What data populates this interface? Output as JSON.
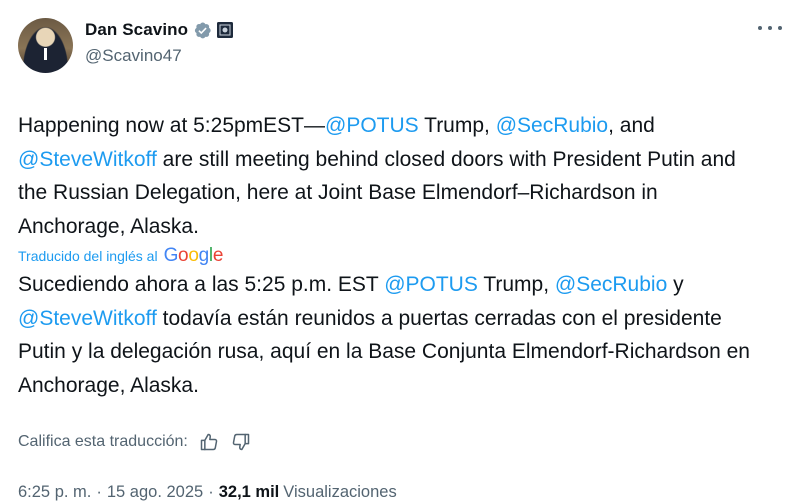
{
  "author": {
    "display_name": "Dan Scavino",
    "handle": "@Scavino47",
    "verified_icon": "verified-badge-icon",
    "affiliation_icon": "government-affiliation-icon"
  },
  "menu_icon": "more-options-icon",
  "tweet": {
    "original": {
      "p1": "Happening now at 5:25pmEST—",
      "m1": "@POTUS",
      "p2": " Trump, ",
      "m2": "@SecRubio",
      "p3": ", and ",
      "m3": "@SteveWitkoff",
      "p4": " are still meeting behind closed doors with President Putin and the Russian Delegation, here at Joint Base Elmendorf–Richardson in Anchorage, Alaska."
    },
    "translated_by_label": "Traducido del inglés al",
    "google_logo": [
      "G",
      "o",
      "o",
      "g",
      "l",
      "e"
    ],
    "translation": {
      "p1": "Sucediendo ahora a las 5:25 p.m. EST ",
      "m1": "@POTUS",
      "p2": " Trump, ",
      "m2": "@SecRubio",
      "p3": " y ",
      "m3": "@SteveWitkoff",
      "p4": " todavía están reunidos a puertas cerradas con el presidente Putin y la delegación rusa, aquí en la Base Conjunta Elmendorf-Richardson en Anchorage, Alaska."
    },
    "rate_label": "Califica esta traducción:",
    "rate_icons": [
      "thumbs-up-icon",
      "thumbs-down-icon"
    ]
  },
  "meta": {
    "time": "6:25 p. m.",
    "separator": "·",
    "date": "15 ago. 2025",
    "views_count": "32,1 mil",
    "views_label": "Visualizaciones"
  },
  "colors": {
    "link": "#1d9bf0",
    "text": "#0f1419",
    "secondary": "#536471",
    "google_blue": "#4285f4",
    "google_red": "#ea4335",
    "google_yellow": "#fbbc05",
    "google_green": "#34a853"
  }
}
